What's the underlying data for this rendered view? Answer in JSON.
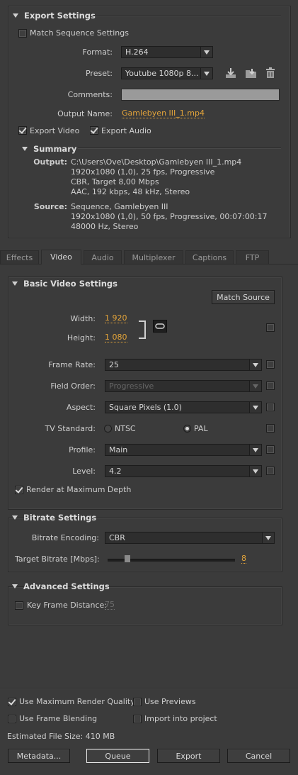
{
  "export_settings": {
    "title": "Export Settings",
    "match_sequence": {
      "label": "Match Sequence Settings",
      "checked": false
    },
    "format": {
      "label": "Format:",
      "value": "H.264"
    },
    "preset": {
      "label": "Preset:",
      "value": "Youtube 1080p 8..."
    },
    "comments": {
      "label": "Comments:",
      "value": ""
    },
    "output_name": {
      "label": "Output Name:",
      "value": "Gamlebyen III_1.mp4"
    },
    "export_video": {
      "label": "Export Video",
      "checked": true
    },
    "export_audio": {
      "label": "Export Audio",
      "checked": true
    },
    "summary": {
      "title": "Summary",
      "output_label": "Output:",
      "output_lines": [
        "C:\\Users\\Ove\\Desktop\\Gamlebyen III_1.mp4",
        "1920x1080 (1,0), 25 fps, Progressive",
        "CBR, Target 8,00 Mbps",
        "AAC, 192 kbps, 48 kHz, Stereo"
      ],
      "source_label": "Source:",
      "source_lines": [
        "Sequence, Gamlebyen III",
        "1920x1080 (1,0), 50 fps, Progressive, 00:07:00:17",
        "48000 Hz, Stereo"
      ]
    }
  },
  "tabs": [
    "Effects",
    "Video",
    "Audio",
    "Multiplexer",
    "Captions",
    "FTP"
  ],
  "active_tab": "Video",
  "basic_video": {
    "title": "Basic Video Settings",
    "match_source": "Match Source",
    "width": {
      "label": "Width:",
      "value": "1 920"
    },
    "height": {
      "label": "Height:",
      "value": "1 080"
    },
    "frame_rate": {
      "label": "Frame Rate:",
      "value": "25"
    },
    "field_order": {
      "label": "Field Order:",
      "value": "Progressive"
    },
    "aspect": {
      "label": "Aspect:",
      "value": "Square Pixels (1.0)"
    },
    "tv_standard": {
      "label": "TV Standard:",
      "ntsc": "NTSC",
      "pal": "PAL",
      "selected": "PAL"
    },
    "profile": {
      "label": "Profile:",
      "value": "Main"
    },
    "level": {
      "label": "Level:",
      "value": "4.2"
    },
    "render_max_depth": {
      "label": "Render at Maximum Depth",
      "checked": true
    }
  },
  "bitrate": {
    "title": "Bitrate Settings",
    "encoding": {
      "label": "Bitrate Encoding:",
      "value": "CBR"
    },
    "target": {
      "label": "Target Bitrate [Mbps]:",
      "value": "8"
    }
  },
  "advanced": {
    "title": "Advanced Settings",
    "key_frame": {
      "label": "Key Frame Distance:",
      "value": "75",
      "checked": false
    }
  },
  "footer": {
    "max_render_quality": {
      "label": "Use Maximum Render Quality",
      "checked": true
    },
    "use_previews": {
      "label": "Use Previews",
      "checked": false
    },
    "frame_blending": {
      "label": "Use Frame Blending",
      "checked": false
    },
    "import_project": {
      "label": "Import into project",
      "checked": false
    },
    "estimated_size": "Estimated File Size:  410 MB",
    "buttons": {
      "metadata": "Metadata...",
      "queue": "Queue",
      "export": "Export",
      "cancel": "Cancel"
    }
  }
}
